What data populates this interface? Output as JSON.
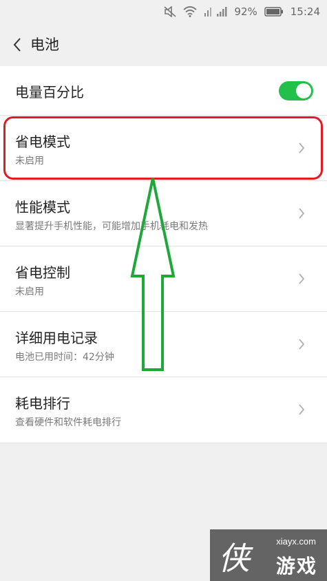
{
  "status_bar": {
    "battery_percent": "92%",
    "time": "15:24",
    "icons": [
      "mute-icon",
      "wifi-icon",
      "signal-icon",
      "battery-icon"
    ]
  },
  "app_bar": {
    "title": "电池",
    "back_icon": "chevron-left-icon"
  },
  "settings": {
    "battery_percentage": {
      "label": "电量百分比",
      "enabled": true
    },
    "items": [
      {
        "title": "省电模式",
        "subtitle": "未启用"
      },
      {
        "title": "性能模式",
        "subtitle": "显著提升手机性能，可能增加手机耗电和发热"
      },
      {
        "title": "省电控制",
        "subtitle": "未启用"
      },
      {
        "title": "详细用电记录",
        "subtitle": "电池已用时间：42分钟"
      },
      {
        "title": "耗电排行",
        "subtitle": "查看硬件和软件耗电排行"
      }
    ]
  },
  "colors": {
    "toggle_on": "#21c04a",
    "highlight_box": "#e21b22",
    "arrow": "#1fa83a"
  },
  "watermark": {
    "site": "xiayx.com",
    "logo_char": "侠",
    "name": "游戏"
  }
}
